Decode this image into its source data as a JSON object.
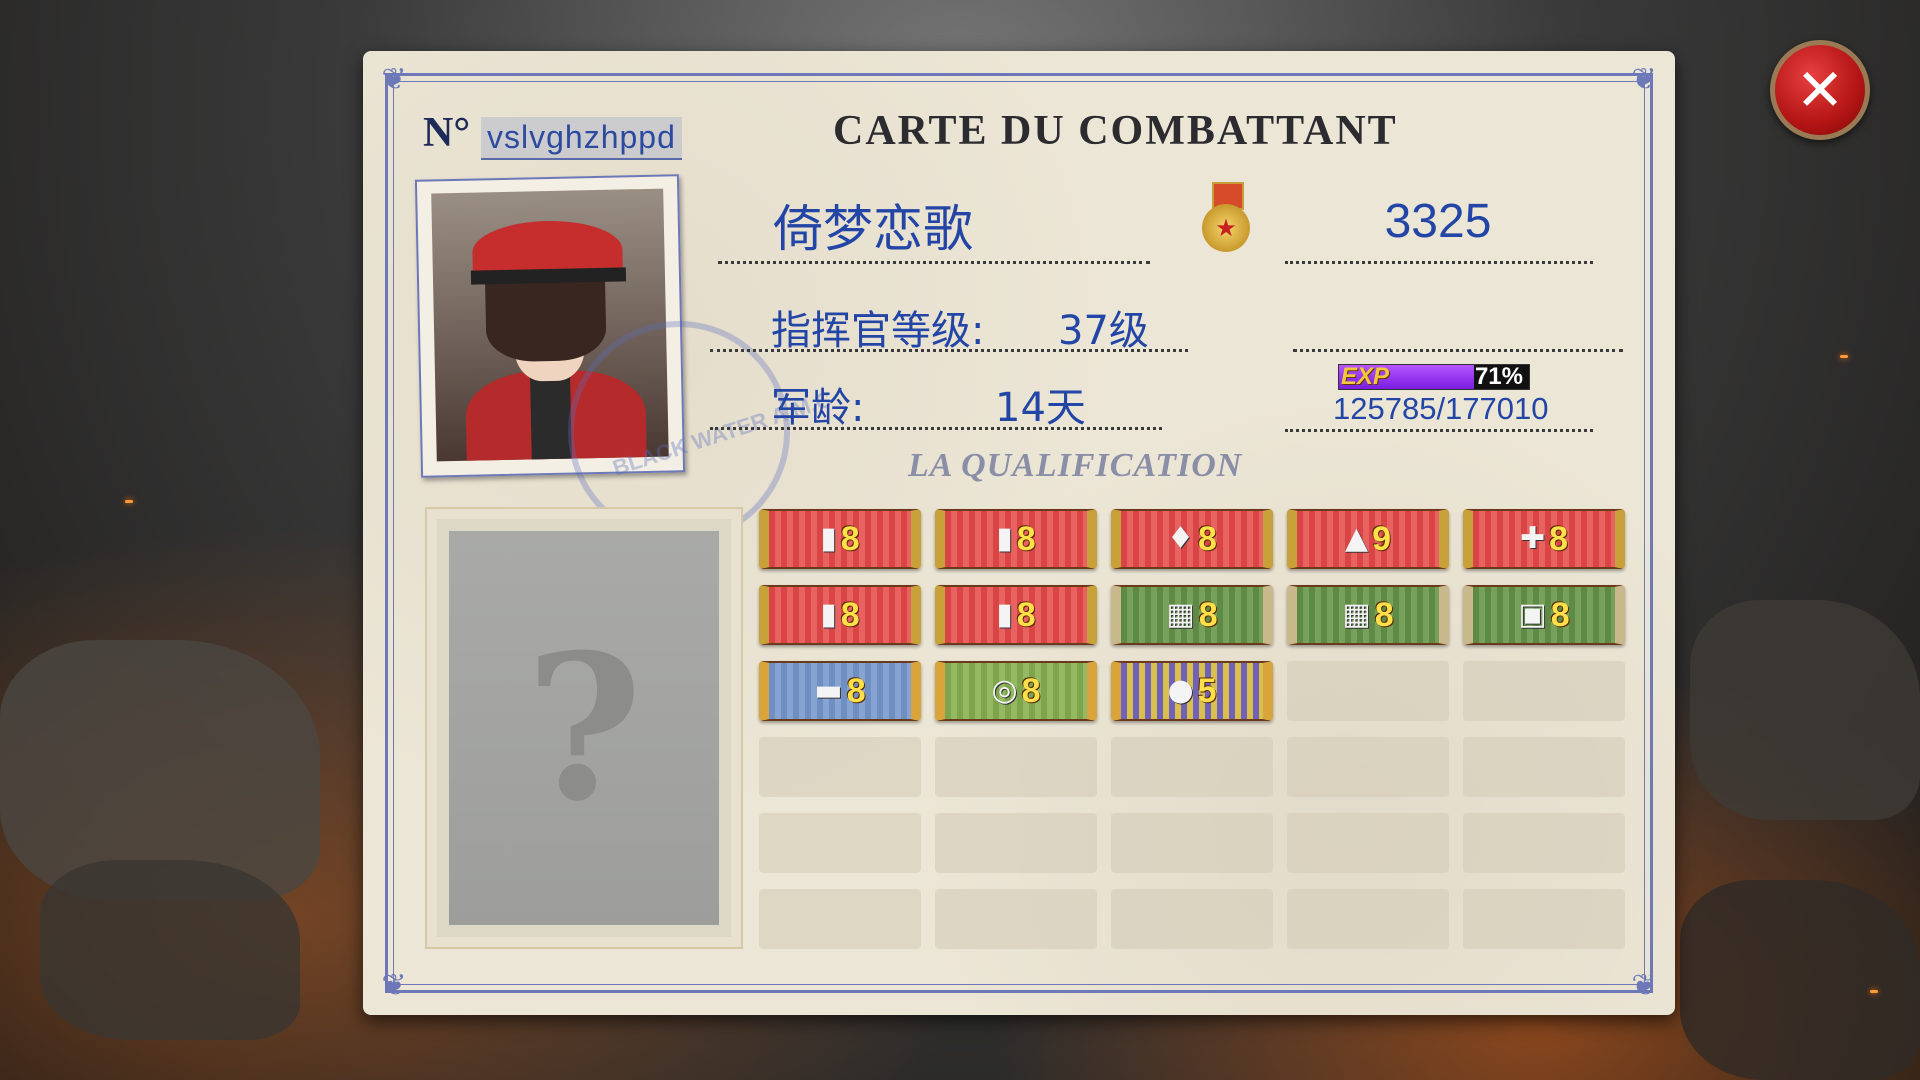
{
  "card": {
    "no_label": "N°",
    "serial": "vslvghzhppd",
    "title": "CARTE  DU  COMBATTANT",
    "player_name": "倚梦恋歌",
    "power": "3325",
    "level_label": "指挥官等级:",
    "level_value": "37级",
    "service_label": "军龄:",
    "service_value": "14天",
    "exp_tag": "EXP",
    "exp_percent_text": "71%",
    "exp_fraction": 0.71,
    "exp_numbers": "125785/177010",
    "qualification_title": "LA QUALIFICATION",
    "unknown_symbol": "?",
    "stamp_text": "BLACK WATER A.M.C"
  },
  "close_glyph": "✕",
  "badges": [
    {
      "icon": "bullet-icon",
      "glyph": "▮",
      "color": "red",
      "level": "8"
    },
    {
      "icon": "shell-icon",
      "glyph": "▮",
      "color": "red",
      "level": "8"
    },
    {
      "icon": "grenade-icon",
      "glyph": "♦",
      "color": "red",
      "level": "8"
    },
    {
      "icon": "cannon-shell-icon",
      "glyph": "▲",
      "color": "red",
      "level": "9"
    },
    {
      "icon": "rocket-icon",
      "glyph": "✚",
      "color": "red",
      "level": "8"
    },
    {
      "icon": "bullet-icon",
      "glyph": "▮",
      "color": "red",
      "level": "8"
    },
    {
      "icon": "gold-shell-icon",
      "glyph": "▮",
      "color": "red",
      "level": "8"
    },
    {
      "icon": "film-icon",
      "glyph": "▦",
      "color": "green",
      "level": "8"
    },
    {
      "icon": "blueprint-icon",
      "glyph": "▦",
      "color": "green",
      "level": "8"
    },
    {
      "icon": "crate-icon",
      "glyph": "▣",
      "color": "green",
      "level": "8"
    },
    {
      "icon": "tank-icon",
      "glyph": "▬",
      "color": "blue",
      "level": "8"
    },
    {
      "icon": "target-icon",
      "glyph": "◎",
      "color": "lime",
      "level": "8"
    },
    {
      "icon": "lightbulb-icon",
      "glyph": "●",
      "color": "purple",
      "level": "5"
    }
  ],
  "total_slots": 30
}
